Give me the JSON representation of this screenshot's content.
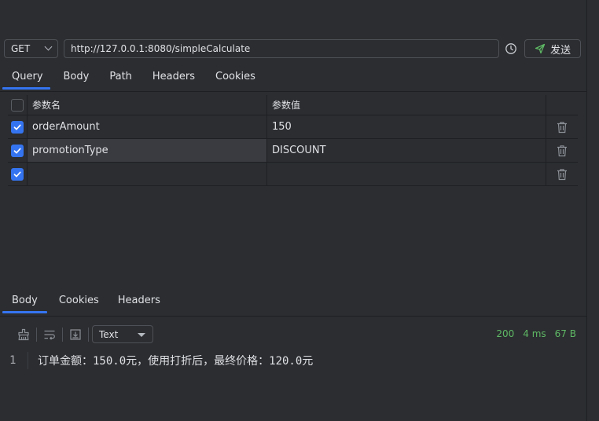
{
  "request": {
    "method": "GET",
    "url": "http://127.0.0.1:8080/simpleCalculate",
    "send_label": "发送"
  },
  "request_tabs": [
    "Query",
    "Body",
    "Path",
    "Headers",
    "Cookies"
  ],
  "params": {
    "columns": [
      "参数名",
      "参数值"
    ],
    "rows": [
      {
        "checked": true,
        "name": "orderAmount",
        "value": "150"
      },
      {
        "checked": true,
        "name": "promotionType",
        "value": "DISCOUNT"
      },
      {
        "checked": true,
        "name": "",
        "value": ""
      }
    ]
  },
  "response_tabs": [
    "Body",
    "Cookies",
    "Headers"
  ],
  "response": {
    "format": "Text",
    "status": "200",
    "time": "4 ms",
    "size": "67 B",
    "lines": [
      {
        "number": "1",
        "text": "订单金额：150.0元，使用打折后，最终价格：120.0元"
      }
    ]
  },
  "colors": {
    "accent": "#3574f0",
    "status_ok": "#5fb865",
    "background": "#2b2d30"
  }
}
